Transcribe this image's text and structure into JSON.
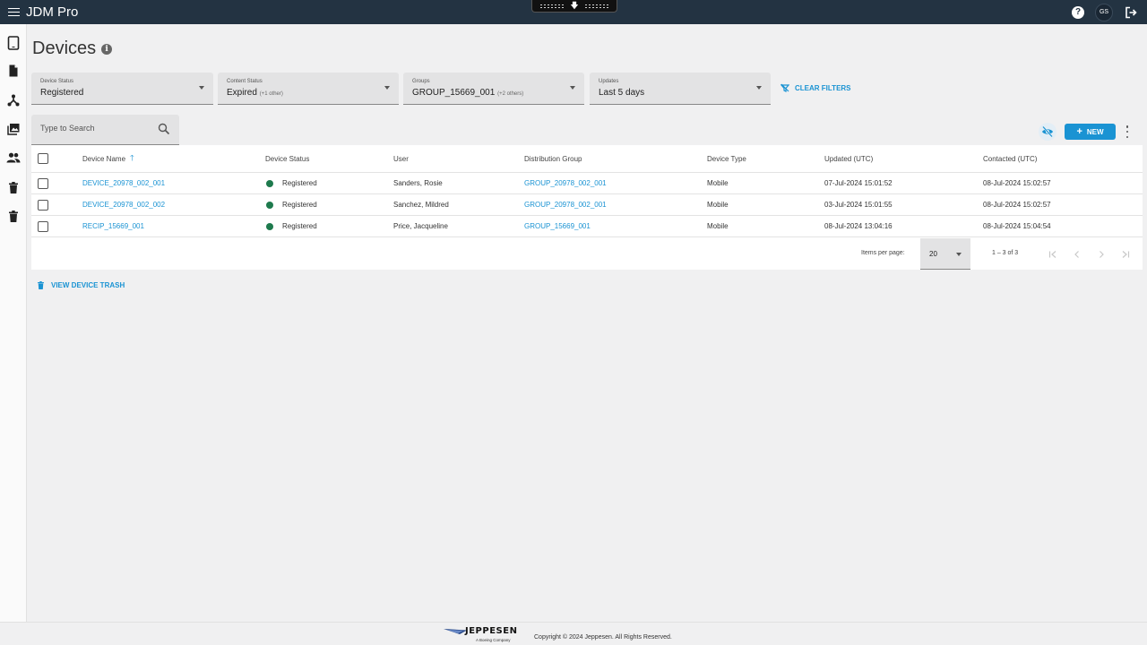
{
  "app": {
    "title": "JDM Pro",
    "user_initials": "GS"
  },
  "page": {
    "title": "Devices"
  },
  "filters": [
    {
      "label": "Device Status",
      "value": "Registered",
      "extra": ""
    },
    {
      "label": "Content Status",
      "value": "Expired",
      "extra": "(+1 other)"
    },
    {
      "label": "Groups",
      "value": "GROUP_15669_001",
      "extra": "(+2 others)"
    },
    {
      "label": "Updates",
      "value": "Last 5 days",
      "extra": ""
    }
  ],
  "clear_filters_label": "CLEAR FILTERS",
  "search": {
    "placeholder": "Type to Search",
    "value": ""
  },
  "toolbar": {
    "new_label": "NEW"
  },
  "table": {
    "columns": [
      "Device Name",
      "Device Status",
      "User",
      "Distribution Group",
      "Device Type",
      "Updated (UTC)",
      "Contacted (UTC)"
    ],
    "rows": [
      {
        "name": "DEVICE_20978_002_001",
        "status": "Registered",
        "user": "Sanders, Rosie",
        "group": "GROUP_20978_002_001",
        "type": "Mobile",
        "updated": "07-Jul-2024 15:01:52",
        "contacted": "08-Jul-2024 15:02:57"
      },
      {
        "name": "DEVICE_20978_002_002",
        "status": "Registered",
        "user": "Sanchez, Mildred",
        "group": "GROUP_20978_002_001",
        "type": "Mobile",
        "updated": "03-Jul-2024 15:01:55",
        "contacted": "08-Jul-2024 15:02:57"
      },
      {
        "name": "RECIP_15669_001",
        "status": "Registered",
        "user": "Price, Jacqueline",
        "group": "GROUP_15669_001",
        "type": "Mobile",
        "updated": "08-Jul-2024 13:04:16",
        "contacted": "08-Jul-2024 15:04:54"
      }
    ]
  },
  "paginator": {
    "items_per_page_label": "Items per page:",
    "items_per_page": "20",
    "range": "1 – 3 of 3"
  },
  "trash_link_label": "VIEW DEVICE TRASH",
  "footer": {
    "logo_word": "JEPPESEN",
    "logo_sub": "A Boeing Company",
    "copyright": "Copyright © 2024 Jeppesen. All Rights Reserved."
  },
  "colors": {
    "topbar": "#233342",
    "accent": "#1a93d3",
    "status_registered": "#1e7a4d"
  },
  "icons": {
    "sidebar": [
      "tablet-icon",
      "document-icon",
      "network-icon",
      "images-icon",
      "group-icon",
      "trash-icon",
      "trash-icon"
    ]
  }
}
